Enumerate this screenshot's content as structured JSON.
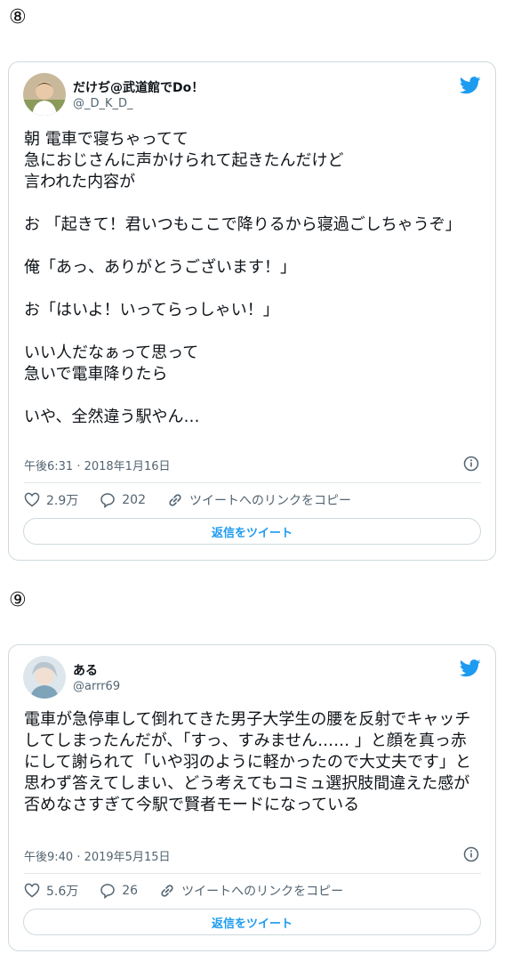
{
  "tweets": [
    {
      "number": "⑧",
      "author_name": "だけぢ@武道館でDo！",
      "handle": "@_D_K_D_",
      "text": "朝 電車で寝ちゃってて\n急におじさんに声かけられて起きたんだけど\n言われた内容が\n\nお 「起きて！君いつもここで降りるから寝過ごしちゃうぞ」\n\n俺「あっ、ありがとうございます！」\n\nお「はいよ！いってらっしゃい！」\n\nいい人だなぁって思って\n急いで電車降りたら\n\nいや、全然違う駅やん…",
      "timestamp": "午後6:31 · 2018年1月16日",
      "likes": "2.9万",
      "replies": "202",
      "copy_link": "ツイートへのリンクをコピー",
      "reply_button": "返信をツイート",
      "avatar_color": "#8a9a5b"
    },
    {
      "number": "⑨",
      "author_name": "ある",
      "handle": "@arrr69",
      "text": "電車が急停車して倒れてきた男子大学生の腰を反射でキャッチしてしまったんだが、「すっ、すみません…… 」と顔を真っ赤にして謝られて「いや羽のように軽かったので大丈夫です」と思わず答えてしまい、どう考えてもコミュ選択肢間違えた感が否めなさすぎて今駅で賢者モードになっている",
      "timestamp": "午後9:40 · 2019年5月15日",
      "likes": "5.6万",
      "replies": "26",
      "copy_link": "ツイートへのリンクをコピー",
      "reply_button": "返信をツイート",
      "avatar_color": "#7fa3b8"
    }
  ],
  "colors": {
    "twitter_blue": "#1d9bf0",
    "secondary_text": "#536471",
    "border": "#cfd9de"
  }
}
